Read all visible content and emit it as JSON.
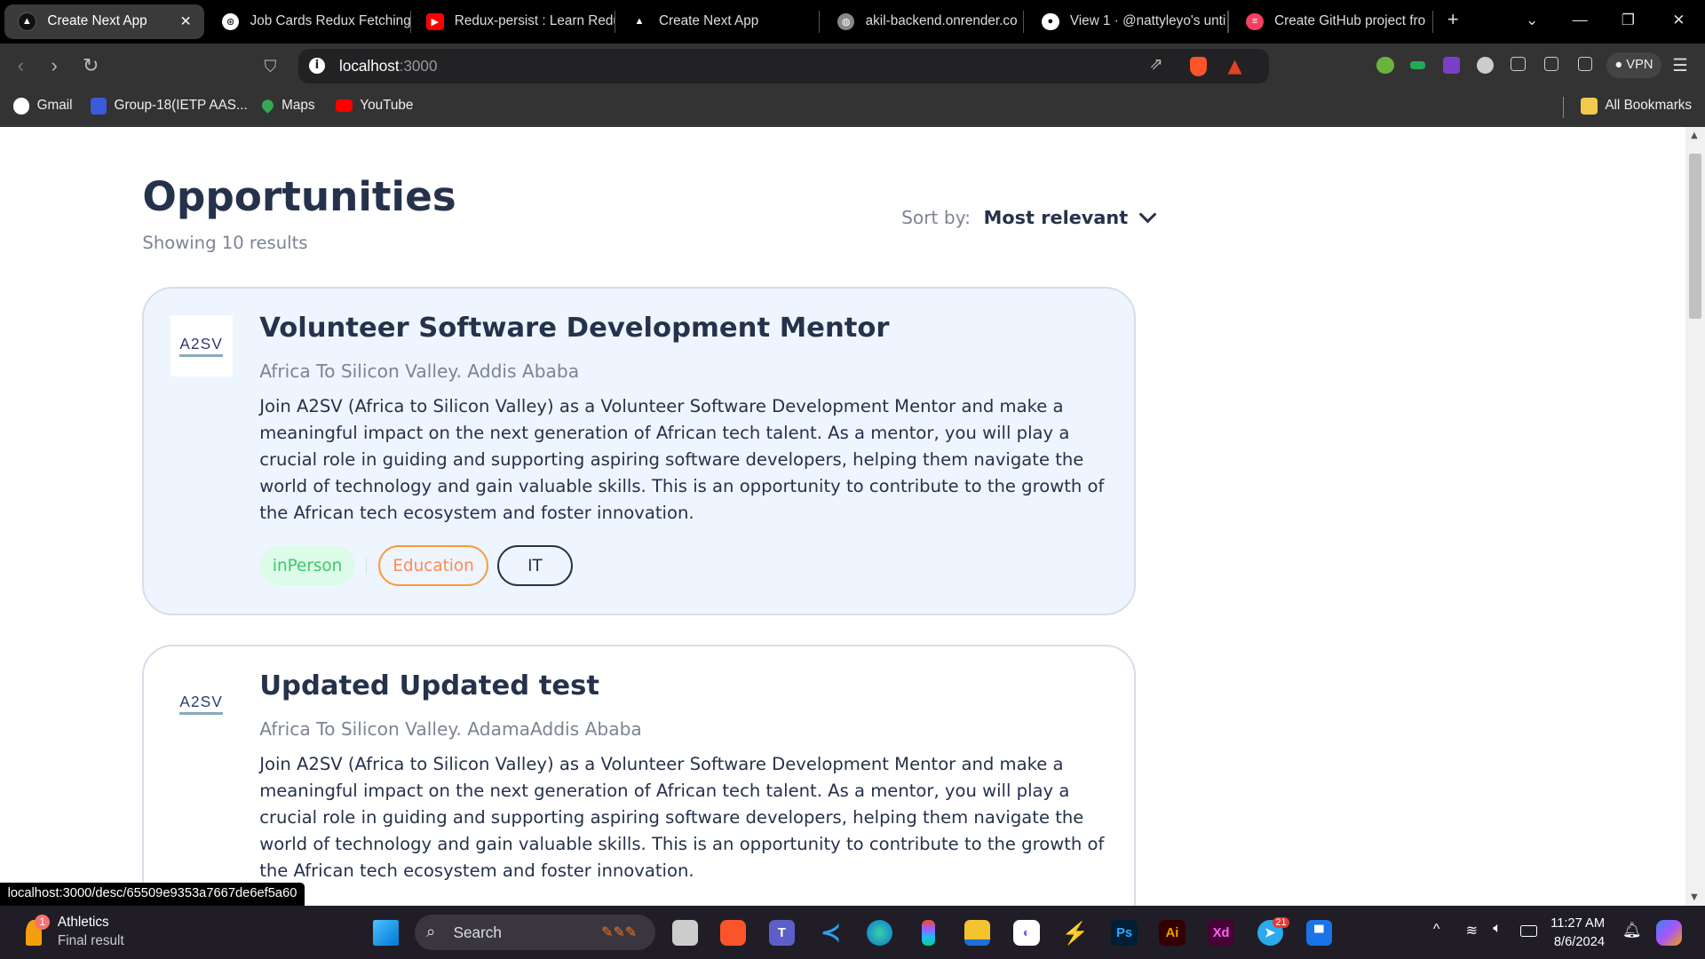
{
  "browser": {
    "tabs": [
      {
        "title": "Create Next App",
        "icon": "nextjs-icon",
        "active": true
      },
      {
        "title": "Job Cards Redux Fetching",
        "icon": "chatgpt-icon"
      },
      {
        "title": "Redux-persist : Learn Redu",
        "icon": "youtube-icon"
      },
      {
        "title": "Create Next App",
        "icon": "nextjs-icon"
      },
      {
        "title": "akil-backend.onrender.co",
        "icon": "globe-icon"
      },
      {
        "title": "View 1 · @nattyleyo's unti",
        "icon": "github-icon"
      },
      {
        "title": "Create GitHub project fro",
        "icon": "app-icon"
      }
    ],
    "url_host": "localhost",
    "url_port": ":3000",
    "vpn_label": "VPN",
    "bookmarks": [
      {
        "label": "Gmail",
        "color": "#ea4335"
      },
      {
        "label": "Group-18(IETP AAS...",
        "color": "#3b5bdb"
      },
      {
        "label": "Maps",
        "color": "#34a853"
      },
      {
        "label": "YouTube",
        "color": "#ff0000"
      }
    ],
    "all_bookmarks": "All Bookmarks",
    "status_url": "localhost:3000/desc/65509e9353a7667de6ef5a60"
  },
  "page": {
    "title": "Opportunities",
    "results": "Showing 10 results",
    "sort_label": "Sort by:",
    "sort_value": "Most relevant",
    "cards": [
      {
        "logo": "A2SV",
        "title": "Volunteer Software Development Mentor",
        "org": "Africa To Silicon Valley. Addis Ababa",
        "description": "Join A2SV (Africa to Silicon Valley) as a Volunteer Software Development Mentor and make a meaningful impact on the next generation of African tech talent. As a mentor, you will play a crucial role in guiding and supporting aspiring software developers, helping them navigate the world of technology and gain valuable skills. This is an opportunity to contribute to the growth of the African tech ecosystem and foster innovation.",
        "tags": [
          "inPerson",
          "Education",
          "IT"
        ]
      },
      {
        "logo": "A2SV",
        "title": "Updated Updated test",
        "org": "Africa To Silicon Valley. AdamaAddis Ababa",
        "description": "Join A2SV (Africa to Silicon Valley) as a Volunteer Software Development Mentor and make a meaningful impact on the next generation of African tech talent. As a mentor, you will play a crucial role in guiding and supporting aspiring software developers, helping them navigate the world of technology and gain valuable skills. This is an opportunity to contribute to the growth of the African tech ecosystem and foster innovation."
      }
    ]
  },
  "taskbar": {
    "widget_title": "Athletics",
    "widget_sub": "Final result",
    "widget_badge": "1",
    "search": "Search",
    "telegram_badge": "21",
    "time": "11:27 AM",
    "date": "8/6/2024",
    "apps": [
      {
        "name": "file-explorer",
        "label": "",
        "bg": "#f4c430",
        "fg": "#1e6fd9"
      },
      {
        "name": "photoshop",
        "label": "Ps",
        "bg": "#001e36",
        "fg": "#31a8ff"
      },
      {
        "name": "illustrator",
        "label": "Ai",
        "bg": "#330000",
        "fg": "#ff9a00"
      },
      {
        "name": "xd",
        "label": "Xd",
        "bg": "#470137",
        "fg": "#ff61f6"
      }
    ]
  }
}
